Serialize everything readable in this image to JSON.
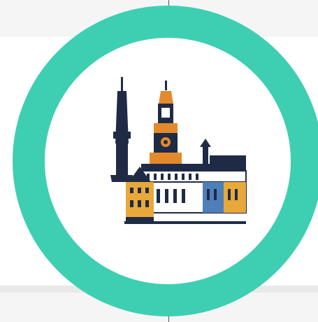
{
  "colors": {
    "ring": "#3ecfb2",
    "background": "#f5f5f5",
    "card": "#ffffff"
  },
  "logo": {
    "icon": "city-hall-skyline-icon"
  }
}
